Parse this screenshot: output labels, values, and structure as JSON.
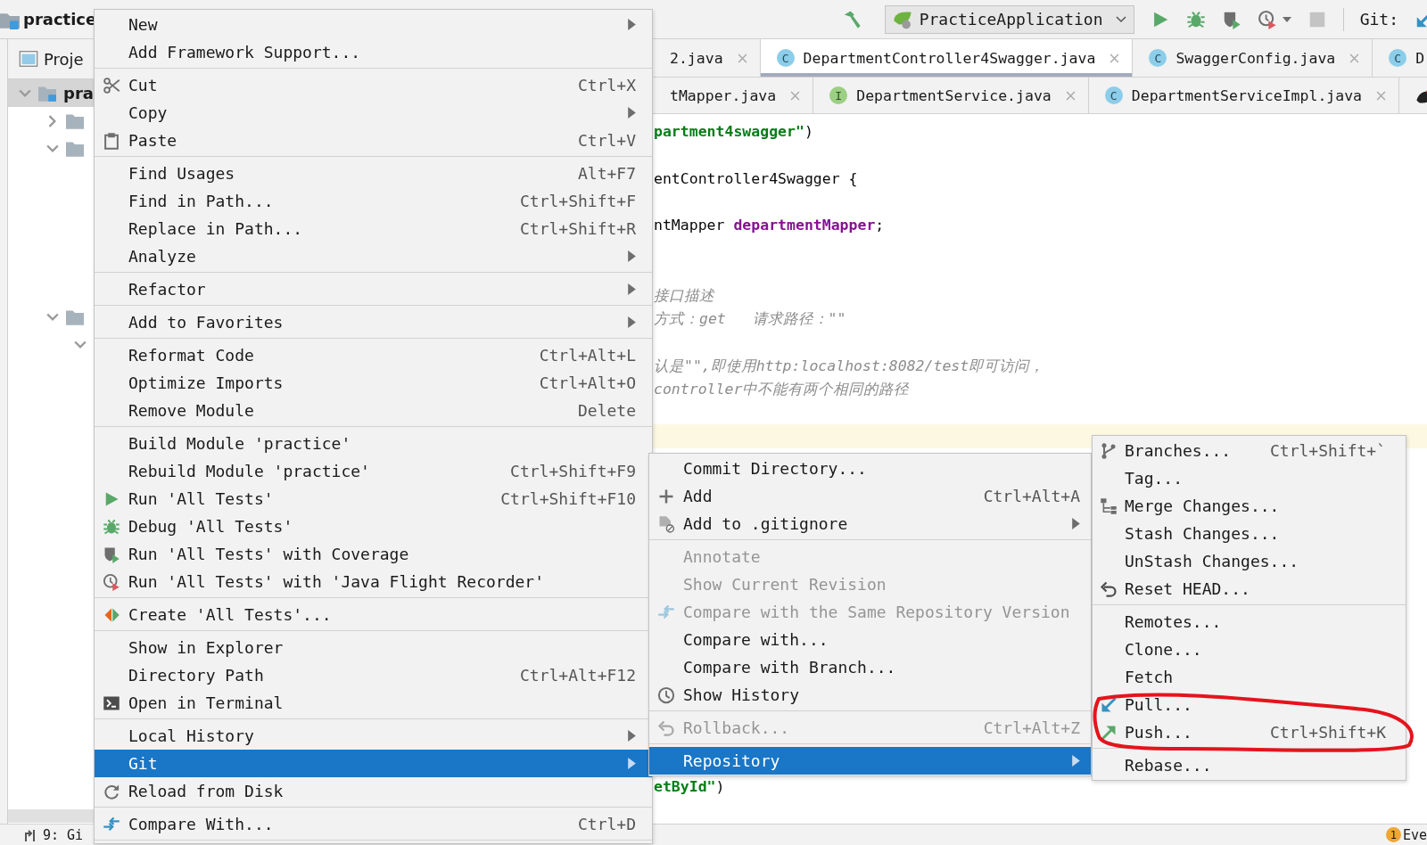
{
  "toolbar": {
    "project": "practice",
    "run_configuration": "PracticeApplication",
    "vcs_label": "Git:"
  },
  "project_panel": {
    "tab": "Proje",
    "tree": [
      {
        "label": "pra",
        "expanded": true,
        "selected": true,
        "children": [
          {
            "expanded": false,
            "selected": false
          },
          {
            "expanded": true,
            "selected": false
          },
          {
            "expanded": true,
            "selected": false,
            "children": [
              {
                "expanded": true,
                "selected": false
              }
            ]
          }
        ]
      }
    ]
  },
  "tab_rows": [
    {
      "tabs": [
        {
          "label": "2.java",
          "selected": false
        },
        {
          "icon": {
            "kind": "class",
            "letter": "C"
          },
          "label": "DepartmentController4Swagger.java",
          "selected": true
        },
        {
          "icon": {
            "kind": "class",
            "letter": "C"
          },
          "label": "SwaggerConfig.java",
          "selected": false
        },
        {
          "icon": {
            "kind": "class",
            "letter": "C"
          },
          "label": "D",
          "selected": false
        }
      ]
    },
    {
      "tabs": [
        {
          "label": "tMapper.java",
          "selected": false
        },
        {
          "icon": {
            "kind": "interface",
            "letter": "I"
          },
          "label": "DepartmentService.java",
          "selected": false
        },
        {
          "icon": {
            "kind": "class",
            "letter": "C"
          },
          "label": "DepartmentServiceImpl.java",
          "selected": false
        },
        {
          "icon": {
            "kind": "plugin"
          },
          "selected": false
        }
      ]
    }
  ],
  "code_lines": [
    {
      "kind": "code",
      "segments": [
        {
          "kind": "string",
          "text": "partment4swagger\""
        },
        {
          "kind": "plain",
          "text": ")"
        }
      ]
    },
    {
      "kind": "blank",
      "current": false
    },
    {
      "kind": "code",
      "segments": [
        {
          "kind": "plain",
          "text": "entController4Swagger {"
        }
      ]
    },
    {
      "kind": "blank",
      "current": false
    },
    {
      "kind": "code",
      "segments": [
        {
          "kind": "plain",
          "text": "ntMapper "
        },
        {
          "kind": "field",
          "text": "departmentMapper"
        },
        {
          "kind": "plain",
          "text": ";"
        }
      ]
    },
    {
      "kind": "blank",
      "current": false
    },
    {
      "kind": "blank",
      "current": false
    },
    {
      "kind": "code",
      "segments": [
        {
          "kind": "comment",
          "text": "接口描述"
        }
      ]
    },
    {
      "kind": "code",
      "segments": [
        {
          "kind": "comment",
          "text": "方式：get   请求路径：\"\""
        }
      ]
    },
    {
      "kind": "blank",
      "current": false
    },
    {
      "kind": "code",
      "segments": [
        {
          "kind": "comment",
          "text": "认是\"\",即使用http:localhost:8082/test即可访问，"
        }
      ]
    },
    {
      "kind": "code",
      "segments": [
        {
          "kind": "comment",
          "text": "controller中不能有两个相同的路径"
        }
      ]
    },
    {
      "kind": "blank",
      "current": false
    },
    {
      "kind": "blank",
      "current": true
    },
    {
      "kind": "blank",
      "current": false
    },
    {
      "kind": "blank",
      "current": false
    },
    {
      "kind": "blank",
      "current": false
    },
    {
      "kind": "blank",
      "current": false
    },
    {
      "kind": "blank",
      "current": false
    },
    {
      "kind": "blank",
      "current": false
    },
    {
      "kind": "blank",
      "current": false
    },
    {
      "kind": "blank",
      "current": false
    },
    {
      "kind": "blank",
      "current": false
    },
    {
      "kind": "blank",
      "current": false
    },
    {
      "kind": "blank",
      "current": false
    },
    {
      "kind": "blank",
      "current": false
    },
    {
      "kind": "blank",
      "current": false
    },
    {
      "kind": "blank",
      "current": false
    },
    {
      "kind": "code",
      "segments": [
        {
          "kind": "string",
          "text": "etById\""
        },
        {
          "kind": "plain",
          "text": ")"
        }
      ]
    }
  ],
  "menus": [
    {
      "items": [
        {
          "kind": "item",
          "label": "New",
          "submenu": true,
          "selected": false,
          "disabled": false
        },
        {
          "kind": "item",
          "label": "Add Framework Support...",
          "selected": false,
          "disabled": false
        },
        {
          "kind": "separator"
        },
        {
          "kind": "item",
          "label": "Cut",
          "shortcut": "Ctrl+X",
          "selected": false,
          "disabled": false
        },
        {
          "kind": "item",
          "label": "Copy",
          "submenu": true,
          "selected": false,
          "disabled": false
        },
        {
          "kind": "item",
          "label": "Paste",
          "shortcut": "Ctrl+V",
          "selected": false,
          "disabled": false
        },
        {
          "kind": "separator"
        },
        {
          "kind": "item",
          "label": "Find Usages",
          "shortcut": "Alt+F7",
          "selected": false,
          "disabled": false
        },
        {
          "kind": "item",
          "label": "Find in Path...",
          "shortcut": "Ctrl+Shift+F",
          "selected": false,
          "disabled": false
        },
        {
          "kind": "item",
          "label": "Replace in Path...",
          "shortcut": "Ctrl+Shift+R",
          "selected": false,
          "disabled": false
        },
        {
          "kind": "item",
          "label": "Analyze",
          "submenu": true,
          "selected": false,
          "disabled": false
        },
        {
          "kind": "separator"
        },
        {
          "kind": "item",
          "label": "Refactor",
          "submenu": true,
          "selected": false,
          "disabled": false
        },
        {
          "kind": "separator"
        },
        {
          "kind": "item",
          "label": "Add to Favorites",
          "submenu": true,
          "selected": false,
          "disabled": false
        },
        {
          "kind": "separator"
        },
        {
          "kind": "item",
          "label": "Reformat Code",
          "shortcut": "Ctrl+Alt+L",
          "selected": false,
          "disabled": false
        },
        {
          "kind": "item",
          "label": "Optimize Imports",
          "shortcut": "Ctrl+Alt+O",
          "selected": false,
          "disabled": false
        },
        {
          "kind": "item",
          "label": "Remove Module",
          "shortcut": "Delete",
          "selected": false,
          "disabled": false
        },
        {
          "kind": "separator"
        },
        {
          "kind": "item",
          "label": "Build Module 'practice'",
          "selected": false,
          "disabled": false
        },
        {
          "kind": "item",
          "label": "Rebuild Module 'practice'",
          "shortcut": "Ctrl+Shift+F9",
          "selected": false,
          "disabled": false
        },
        {
          "kind": "item",
          "label": "Run 'All Tests'",
          "shortcut": "Ctrl+Shift+F10",
          "selected": false,
          "disabled": false
        },
        {
          "kind": "item",
          "label": "Debug 'All Tests'",
          "selected": false,
          "disabled": false
        },
        {
          "kind": "item",
          "label": "Run 'All Tests' with Coverage",
          "selected": false,
          "disabled": false
        },
        {
          "kind": "item",
          "label": "Run 'All Tests' with 'Java Flight Recorder'",
          "selected": false,
          "disabled": false
        },
        {
          "kind": "separator"
        },
        {
          "kind": "item",
          "label": "Create 'All Tests'...",
          "selected": false,
          "disabled": false
        },
        {
          "kind": "separator"
        },
        {
          "kind": "item",
          "label": "Show in Explorer",
          "selected": false,
          "disabled": false
        },
        {
          "kind": "item",
          "label": "Directory Path",
          "shortcut": "Ctrl+Alt+F12",
          "selected": false,
          "disabled": false
        },
        {
          "kind": "item",
          "label": "Open in Terminal",
          "selected": false,
          "disabled": false
        },
        {
          "kind": "separator"
        },
        {
          "kind": "item",
          "label": "Local History",
          "submenu": true,
          "selected": false,
          "disabled": false
        },
        {
          "kind": "item",
          "label": "Git",
          "submenu": true,
          "selected": true,
          "disabled": false
        },
        {
          "kind": "item",
          "label": "Reload from Disk",
          "selected": false,
          "disabled": false
        },
        {
          "kind": "separator"
        },
        {
          "kind": "item",
          "label": "Compare With...",
          "shortcut": "Ctrl+D",
          "selected": false,
          "disabled": false
        },
        {
          "kind": "separator"
        }
      ]
    },
    {
      "items": [
        {
          "kind": "item",
          "label": "Commit Directory...",
          "selected": false,
          "disabled": false
        },
        {
          "kind": "item",
          "label": "Add",
          "shortcut": "Ctrl+Alt+A",
          "selected": false,
          "disabled": false
        },
        {
          "kind": "item",
          "label": "Add to .gitignore",
          "submenu": true,
          "selected": false,
          "disabled": false
        },
        {
          "kind": "separator"
        },
        {
          "kind": "item",
          "label": "Annotate",
          "selected": false,
          "disabled": true
        },
        {
          "kind": "item",
          "label": "Show Current Revision",
          "selected": false,
          "disabled": true
        },
        {
          "kind": "item",
          "label": "Compare with the Same Repository Version",
          "selected": false,
          "disabled": true
        },
        {
          "kind": "item",
          "label": "Compare with...",
          "selected": false,
          "disabled": false
        },
        {
          "kind": "item",
          "label": "Compare with Branch...",
          "selected": false,
          "disabled": false
        },
        {
          "kind": "item",
          "label": "Show History",
          "selected": false,
          "disabled": false
        },
        {
          "kind": "separator"
        },
        {
          "kind": "item",
          "label": "Rollback...",
          "shortcut": "Ctrl+Alt+Z",
          "selected": false,
          "disabled": true
        },
        {
          "kind": "separator"
        },
        {
          "kind": "item",
          "label": "Repository",
          "submenu": true,
          "selected": true,
          "disabled": false
        }
      ]
    },
    {
      "items": [
        {
          "kind": "item",
          "label": "Branches...",
          "shortcut": "Ctrl+Shift+`",
          "selected": false,
          "disabled": false
        },
        {
          "kind": "item",
          "label": "Tag...",
          "selected": false,
          "disabled": false
        },
        {
          "kind": "item",
          "label": "Merge Changes...",
          "selected": false,
          "disabled": false
        },
        {
          "kind": "item",
          "label": "Stash Changes...",
          "selected": false,
          "disabled": false
        },
        {
          "kind": "item",
          "label": "UnStash Changes...",
          "selected": false,
          "disabled": false
        },
        {
          "kind": "item",
          "label": "Reset HEAD...",
          "selected": false,
          "disabled": false
        },
        {
          "kind": "separator"
        },
        {
          "kind": "item",
          "label": "Remotes...",
          "selected": false,
          "disabled": false
        },
        {
          "kind": "item",
          "label": "Clone...",
          "selected": false,
          "disabled": false
        },
        {
          "kind": "item",
          "label": "Fetch",
          "selected": false,
          "disabled": false
        },
        {
          "kind": "item",
          "label": "Pull...",
          "selected": false,
          "disabled": false
        },
        {
          "kind": "item",
          "label": "Push...",
          "shortcut": "Ctrl+Shift+K",
          "selected": false,
          "disabled": false
        },
        {
          "kind": "separator"
        },
        {
          "kind": "item",
          "label": "Rebase...",
          "selected": false,
          "disabled": false
        }
      ]
    }
  ],
  "status_bar": {
    "tool_window": "9: Gi",
    "notification_count": "1",
    "notification_label": "Eve"
  }
}
